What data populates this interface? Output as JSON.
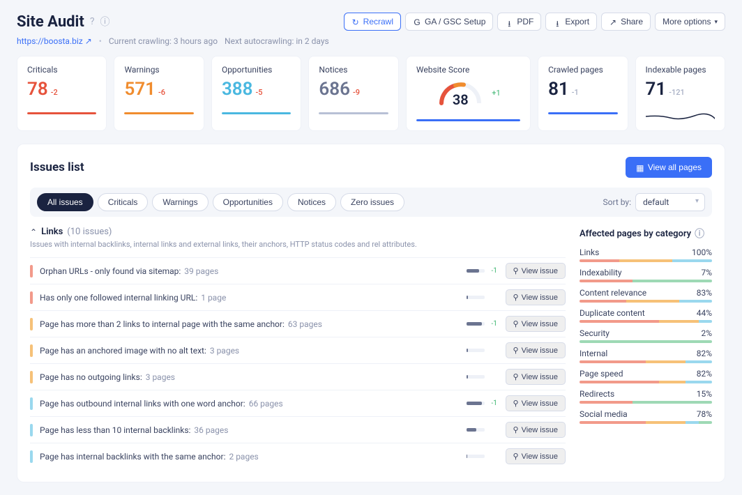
{
  "header": {
    "title": "Site Audit",
    "url": "https://boosta.biz",
    "crawl_status": "Current crawling: 3 hours ago",
    "next_crawl": "Next autocrawling: in 2 days"
  },
  "actions": {
    "recrawl": "Recrawl",
    "ga": "GA / GSC Setup",
    "pdf": "PDF",
    "export": "Export",
    "share": "Share",
    "more": "More options"
  },
  "cards": [
    {
      "label": "Criticals",
      "value": "78",
      "delta": "-2",
      "color": "red"
    },
    {
      "label": "Warnings",
      "value": "571",
      "delta": "-6",
      "color": "orange"
    },
    {
      "label": "Opportunities",
      "value": "388",
      "delta": "-5",
      "color": "cyan"
    },
    {
      "label": "Notices",
      "value": "686",
      "delta": "-9",
      "color": "gray"
    }
  ],
  "score": {
    "label": "Website Score",
    "value": "38",
    "delta": "+1"
  },
  "crawled": {
    "label": "Crawled pages",
    "value": "81",
    "delta": "-1"
  },
  "indexable": {
    "label": "Indexable pages",
    "value": "71",
    "delta": "-121"
  },
  "issues_panel": {
    "title": "Issues list",
    "view_all": "View all pages",
    "sort_label": "Sort by:",
    "sort_value": "default"
  },
  "pills": [
    "All issues",
    "Criticals",
    "Warnings",
    "Opportunities",
    "Notices",
    "Zero issues"
  ],
  "section": {
    "name": "Links",
    "count": "(10 issues)",
    "desc": "Issues with internal backlinks, internal links and external links, their anchors, HTTP status codes and rel attributes."
  },
  "issues": [
    {
      "tag": "red",
      "text": "Orphan URLs - only found via sitemap:",
      "pages": "39 pages",
      "delta": "-1",
      "fill": 70
    },
    {
      "tag": "red",
      "text": "Has only one followed internal linking URL:",
      "pages": "1 page",
      "delta": "",
      "fill": 10
    },
    {
      "tag": "orange",
      "text": "Page has more than 2 links to internal page with the same anchor:",
      "pages": "63 pages",
      "delta": "-1",
      "fill": 85
    },
    {
      "tag": "orange",
      "text": "Page has an anchored image with no alt text:",
      "pages": "3 pages",
      "delta": "",
      "fill": 8
    },
    {
      "tag": "orange",
      "text": "Page has no outgoing links:",
      "pages": "3 pages",
      "delta": "",
      "fill": 8
    },
    {
      "tag": "cyan",
      "text": "Page has outbound internal links with one word anchor:",
      "pages": "66 pages",
      "delta": "-1",
      "fill": 88
    },
    {
      "tag": "cyan",
      "text": "Page has less than 10 internal backlinks:",
      "pages": "36 pages",
      "delta": "",
      "fill": 55
    },
    {
      "tag": "cyan",
      "text": "Page has internal backlinks with the same anchor:",
      "pages": "2 pages",
      "delta": "",
      "fill": 6
    }
  ],
  "view_issue_label": "View issue",
  "categories_title": "Affected pages by category",
  "categories": [
    {
      "name": "Links",
      "pct": "100%",
      "seg": [
        30,
        40,
        30,
        0
      ]
    },
    {
      "name": "Indexability",
      "pct": "7%",
      "seg": [
        40,
        0,
        0,
        60
      ]
    },
    {
      "name": "Content relevance",
      "pct": "83%",
      "seg": [
        35,
        40,
        25,
        0
      ]
    },
    {
      "name": "Duplicate content",
      "pct": "44%",
      "seg": [
        60,
        30,
        10,
        0
      ]
    },
    {
      "name": "Security",
      "pct": "2%",
      "seg": [
        0,
        0,
        0,
        100
      ]
    },
    {
      "name": "Internal",
      "pct": "82%",
      "seg": [
        50,
        30,
        20,
        0
      ]
    },
    {
      "name": "Page speed",
      "pct": "82%",
      "seg": [
        60,
        20,
        20,
        0
      ]
    },
    {
      "name": "Redirects",
      "pct": "15%",
      "seg": [
        40,
        0,
        0,
        60
      ]
    },
    {
      "name": "Social media",
      "pct": "78%",
      "seg": [
        50,
        30,
        10,
        10
      ]
    }
  ]
}
